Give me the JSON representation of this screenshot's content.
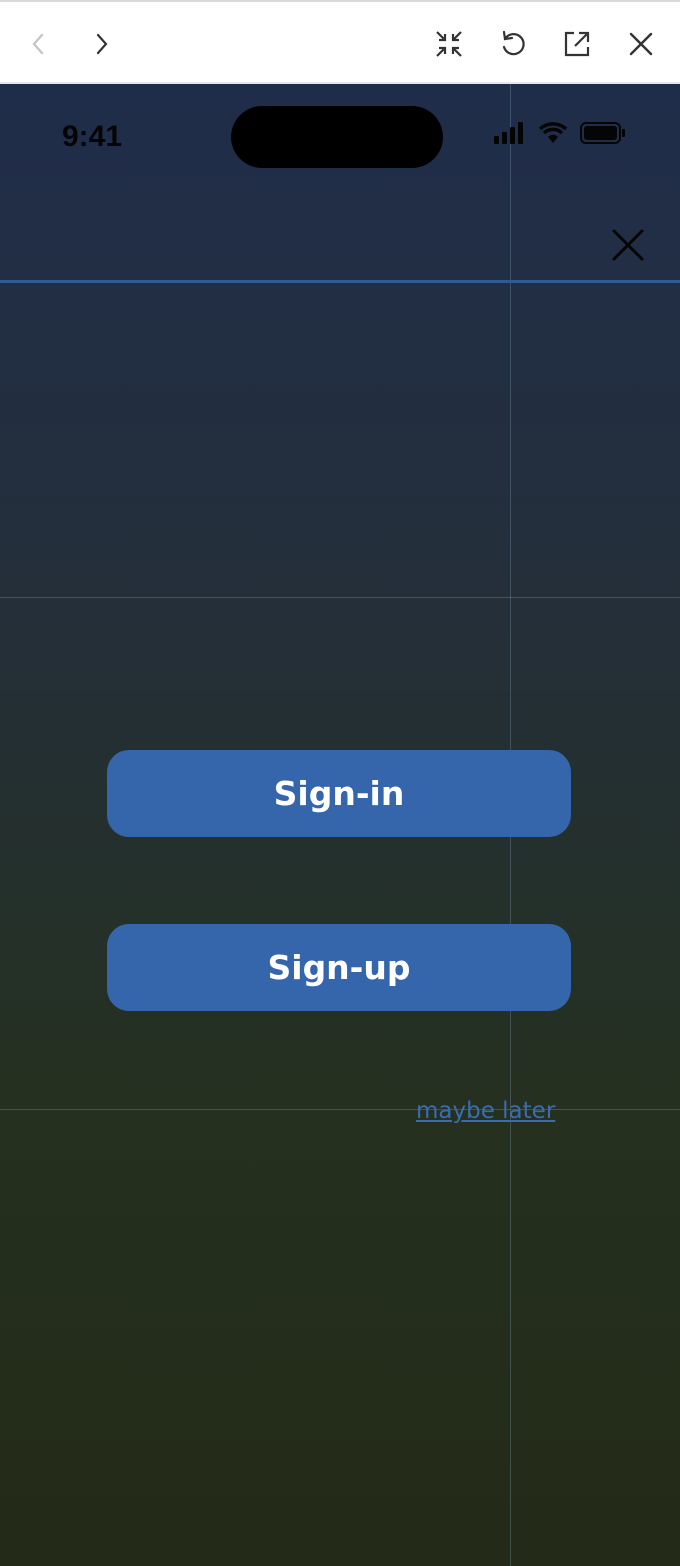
{
  "toolbar": {
    "back_icon": "chevron-left-icon",
    "forward_icon": "chevron-right-icon",
    "collapse_icon": "collapse-icon",
    "reload_icon": "reload-icon",
    "open_external_icon": "open-external-icon",
    "close_icon": "close-icon"
  },
  "status_bar": {
    "time": "9:41"
  },
  "auth": {
    "signin_label": "Sign-in",
    "signup_label": "Sign-up",
    "maybe_later_label": "maybe later"
  },
  "colors": {
    "button": "#3566ab",
    "link": "#3a6cb0",
    "header_line": "#2f5a9a"
  }
}
